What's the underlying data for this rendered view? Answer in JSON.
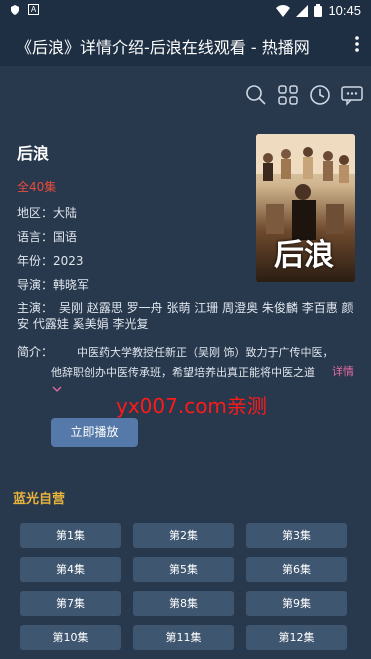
{
  "status_bar": {
    "time": "10:45"
  },
  "app_bar": {
    "title": "《后浪》详情介绍-后浪在线观看 - 热播网"
  },
  "toolbar_icons": [
    "search-icon",
    "grid-icon",
    "history-icon",
    "chat-icon"
  ],
  "video": {
    "title": "后浪",
    "episodes": "全40集",
    "region_label": "地区：",
    "region": "大陆",
    "language_label": "语言：",
    "language": "国语",
    "year_label": "年份：",
    "year": "2023",
    "director_label": "导演：",
    "director": "韩晓军",
    "cast_label": "主演：",
    "cast": "吴刚 赵露思 罗一舟 张萌 江珊 周澄奥 朱俊麟 李百惠 颜安 代露娃 奚美娟 李光复",
    "intro_label": "简介：",
    "intro": "中医药大学教授任新正（吴刚 饰）致力于广传中医，他辞职创办中医传承班，希望培养出真正能将中医之道",
    "more_label": "详情",
    "poster_text": "后浪"
  },
  "watermark": "yx007.com亲测",
  "play_button": "立即播放",
  "source_title": "蓝光自营",
  "episode_buttons": [
    "第1集",
    "第2集",
    "第3集",
    "第4集",
    "第5集",
    "第6集",
    "第7集",
    "第8集",
    "第9集",
    "第10集",
    "第11集",
    "第12集"
  ],
  "colors": {
    "background": "#28384d",
    "accent_episodes": "#e74c3c",
    "source_title": "#e8b33c",
    "play_button": "#5579a8",
    "episode_button": "#3f5670"
  }
}
